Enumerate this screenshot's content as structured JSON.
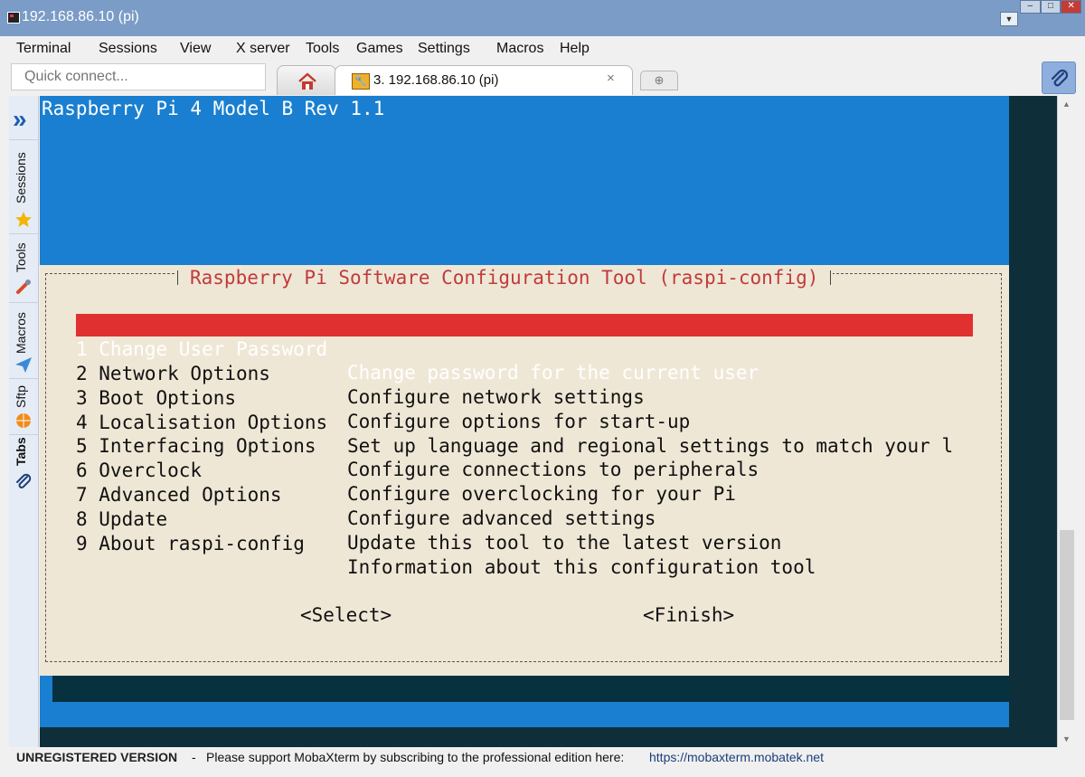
{
  "window": {
    "title": "192.168.86.10 (pi)"
  },
  "menu": [
    "Terminal",
    "Sessions",
    "View",
    "X server",
    "Tools",
    "Games",
    "Settings",
    "Macros",
    "Help"
  ],
  "quick_connect": {
    "placeholder": "Quick connect..."
  },
  "tabs": {
    "active_label": "3. 192.168.86.10 (pi)",
    "close_glyph": "×",
    "new_tab_glyph": "⊕"
  },
  "sidebar": {
    "tabs": [
      "Sessions",
      "Tools",
      "Macros",
      "Sftp",
      "Tabs"
    ]
  },
  "terminal": {
    "host_line": "Raspberry Pi 4 Model B Rev 1.1",
    "dialog_title": "Raspberry Pi Software Configuration Tool (raspi-config)",
    "menu_items": [
      {
        "option": "1 Change User Password",
        "description": "Change password for the current user"
      },
      {
        "option": "2 Network Options",
        "description": "Configure network settings"
      },
      {
        "option": "3 Boot Options",
        "description": "Configure options for start-up"
      },
      {
        "option": "4 Localisation Options",
        "description": "Set up language and regional settings to match your l"
      },
      {
        "option": "5 Interfacing Options",
        "description": "Configure connections to peripherals"
      },
      {
        "option": "6 Overclock",
        "description": "Configure overclocking for your Pi"
      },
      {
        "option": "7 Advanced Options",
        "description": "Configure advanced settings"
      },
      {
        "option": "8 Update",
        "description": "Update this tool to the latest version"
      },
      {
        "option": "9 About raspi-config",
        "description": "Information about this configuration tool"
      }
    ],
    "buttons": {
      "select": "<Select>",
      "finish": "<Finish>"
    }
  },
  "status": {
    "unregistered": "UNREGISTERED VERSION",
    "dash": "-",
    "support_text": "Please support MobaXterm by subscribing to the professional edition here:",
    "link": "https://mobaxterm.mobatek.net"
  },
  "colors": {
    "terminal_bg": "#1a7fd0",
    "dialog_bg": "#efe7d6",
    "dialog_title": "#c03b3b",
    "selected_row": "#e03030",
    "titlebar": "#7a9cc6"
  }
}
